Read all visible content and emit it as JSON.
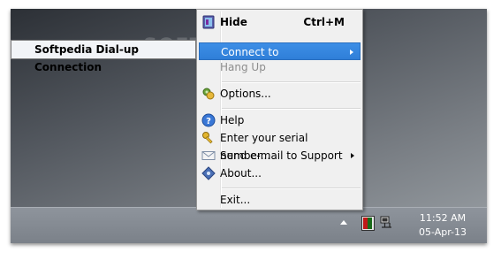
{
  "tooltip": {
    "text": "Softpedia Dial-up Connection"
  },
  "menu": {
    "items": [
      {
        "label": "Hide",
        "accel": "Ctrl+M",
        "icon": "app-window-icon"
      },
      {
        "label": "Connect to",
        "icon": ""
      },
      {
        "label": "Hang Up",
        "icon": ""
      },
      {
        "label": "Options...",
        "icon": "gear-puzzle-icon"
      },
      {
        "label": "Help",
        "icon": "help-icon"
      },
      {
        "label": "Enter your serial number...",
        "icon": "key-icon"
      },
      {
        "label": "Send e-mail to Support",
        "icon": "envelope-icon"
      },
      {
        "label": "About...",
        "icon": "info-diamond-icon"
      },
      {
        "label": "Exit...",
        "icon": ""
      }
    ]
  },
  "taskbar": {
    "time": "11:52 AM",
    "date": "05-Apr-13"
  },
  "colors": {
    "highlight": "#3d8ee6",
    "menu_bg": "#f0f0f0",
    "taskbar": "#858b93"
  }
}
